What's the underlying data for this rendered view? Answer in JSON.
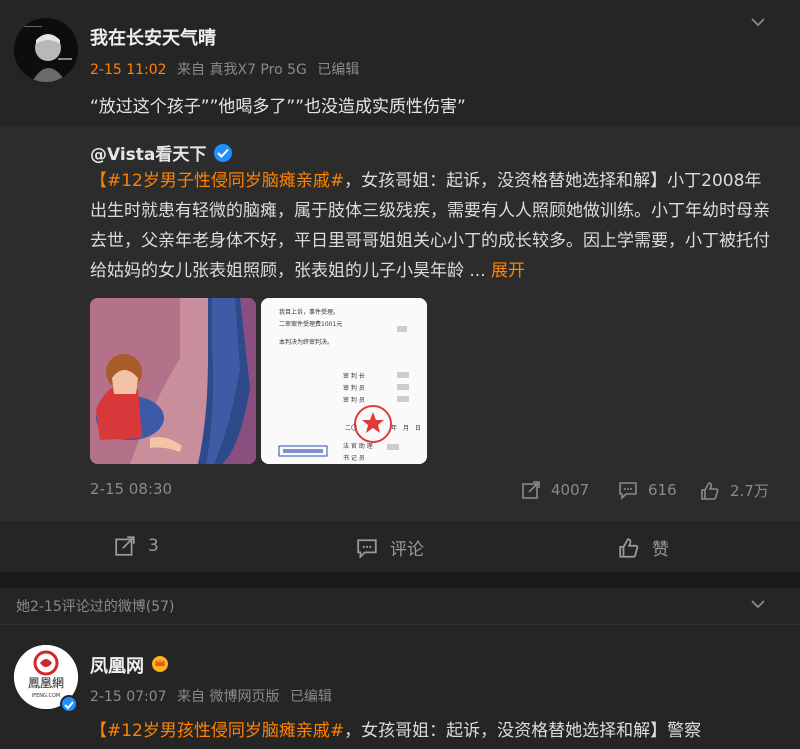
{
  "post": {
    "nickname": "我在长安天气晴",
    "time": "2-15 11:02",
    "source": "来自 真我X7 Pro 5G",
    "edited": "已编辑",
    "text": "“放过这个孩子””他喝多了””也没造成实质性伤害”"
  },
  "repost": {
    "author": "@Vista看天下",
    "hashtag": "【#12岁男子性侵同岁脑瘫亲戚#",
    "body": "，女孩哥姐：起诉，没资格替她选择和解】小丁2008年出生时就患有轻微的脑瘫，属于肢体三级残疾，需要有人人照顾她做训练。小丁年幼时母亲去世，父亲年老身体不好，平日里哥哥姐姐关心小丁的成长较多。因上学需要，小丁被托付给姑妈的女儿张表姐照顾，张表姐的儿子小昊年龄 ... ",
    "more": "展开",
    "time": "2-15 08:30",
    "reposts": "4007",
    "comments": "616",
    "likes": "2.7万",
    "doc_lines": [
      "我目上诉，事件受理。",
      "二审案件受理费1001元",
      "本判决为终审判决。",
      "审 判 长",
      "审 判 员",
      "审 判 员",
      "二〇",
      "年",
      "月",
      "日",
      "法 官 助 理",
      "书 记 员"
    ]
  },
  "actions": {
    "share_count": "3",
    "comment_label": "评论",
    "like_label": "赞"
  },
  "section": {
    "title": "她2-15评论过的微博(57)"
  },
  "post2": {
    "nickname": "凤凰网",
    "avatar_text": "鳳凰網",
    "avatar_sub": "IFENG.COM",
    "time": "2-15 07:07",
    "source": "来自 微博网页版",
    "edited": "已编辑",
    "hashtag": "【#12岁男孩性侵同岁脑瘫亲戚#",
    "text": "，女孩哥姐：起诉，没资格替她选择和解】警察"
  },
  "colors": {
    "accent": "#ff8200",
    "verified": "#1e90ff",
    "background": "#1f1f1f",
    "card": "#252525",
    "repost_bg": "#2c2c2c"
  }
}
